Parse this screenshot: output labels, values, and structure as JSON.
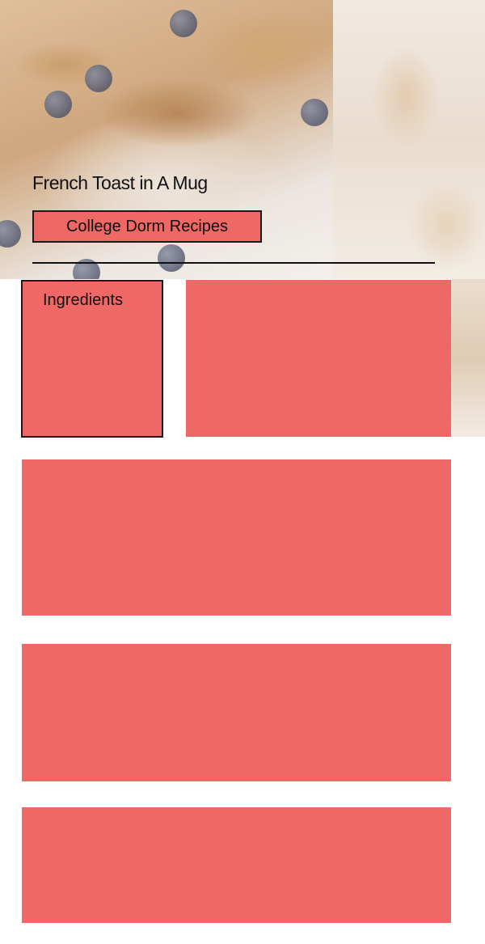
{
  "header": {
    "title": "French Toast in A Mug",
    "subtitle": "College Dorm Recipes"
  },
  "ingredients": {
    "label": "Ingredients"
  },
  "colors": {
    "accent": "#ee6866",
    "text": "#111111",
    "border": "#1a1a1a"
  }
}
